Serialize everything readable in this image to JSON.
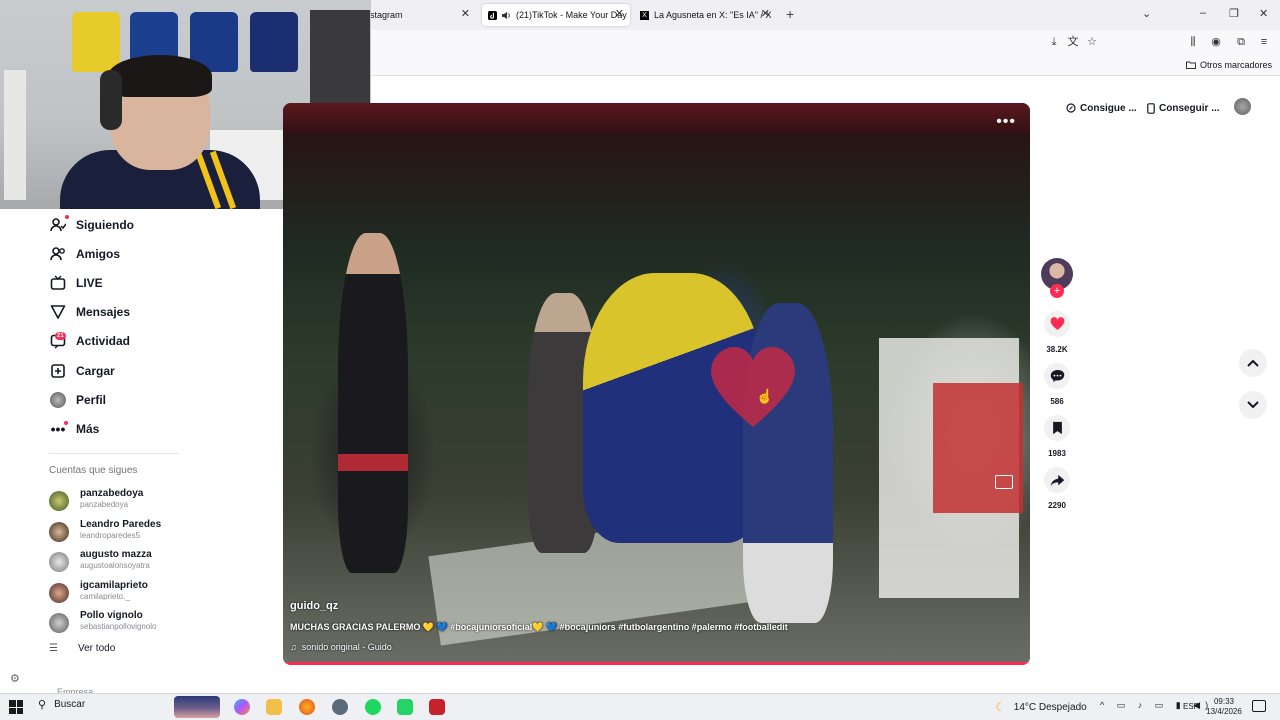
{
  "browser": {
    "tabs": [
      {
        "title": "stagram",
        "active": false
      },
      {
        "title": "(21)TikTok - Make Your Day",
        "active": true
      },
      {
        "title": "La Agusneta en X: \"Es IA\" / X",
        "active": false
      }
    ],
    "new_tab": "+",
    "close_glyph": "✕",
    "bookmarks_other": "Otros marcadores"
  },
  "sidebar": {
    "items": [
      {
        "label": "Siguiendo",
        "icon": "following-icon"
      },
      {
        "label": "Amigos",
        "icon": "friends-icon"
      },
      {
        "label": "LIVE",
        "icon": "live-icon"
      },
      {
        "label": "Mensajes",
        "icon": "messages-icon"
      },
      {
        "label": "Actividad",
        "icon": "activity-icon",
        "badge": "21"
      },
      {
        "label": "Cargar",
        "icon": "upload-icon"
      },
      {
        "label": "Perfil",
        "icon": "profile-avatar"
      },
      {
        "label": "Más",
        "icon": "more-icon"
      }
    ],
    "following_title": "Cuentas que sigues",
    "accounts": [
      {
        "name": "panzabedoya",
        "user": "panzabedoya"
      },
      {
        "name": "Leandro Paredes",
        "user": "leandroparedes5"
      },
      {
        "name": "augusto mazza",
        "user": "augustoalonsoyatra"
      },
      {
        "name": "igcamilaprieto",
        "user": "camilaprieto._"
      },
      {
        "name": "Pollo vignolo",
        "user": "sebastianpollovignolo"
      }
    ],
    "see_all": "Ver todo",
    "company": "Empresa"
  },
  "header": {
    "get_coins": "Consigue ...",
    "get_app": "Conseguir ..."
  },
  "video": {
    "author": "guido_qz",
    "description": "MUCHAS GRACIAS PALERMO 💛 💙 #bocajuniorsoficial💛 💙 #bocajuniors #futbolargentino #palermo #footballedit",
    "sound": "sonido original - Guido",
    "more": "•••"
  },
  "actions": {
    "likes": "38.2K",
    "comments": "586",
    "saves": "1983",
    "shares": "2290",
    "like_color": "#fe2c55"
  },
  "taskbar": {
    "search": "Buscar",
    "weather": "14°C  Despejado",
    "lang": "ESP",
    "time": "09:33",
    "date": "13/4/2026"
  }
}
